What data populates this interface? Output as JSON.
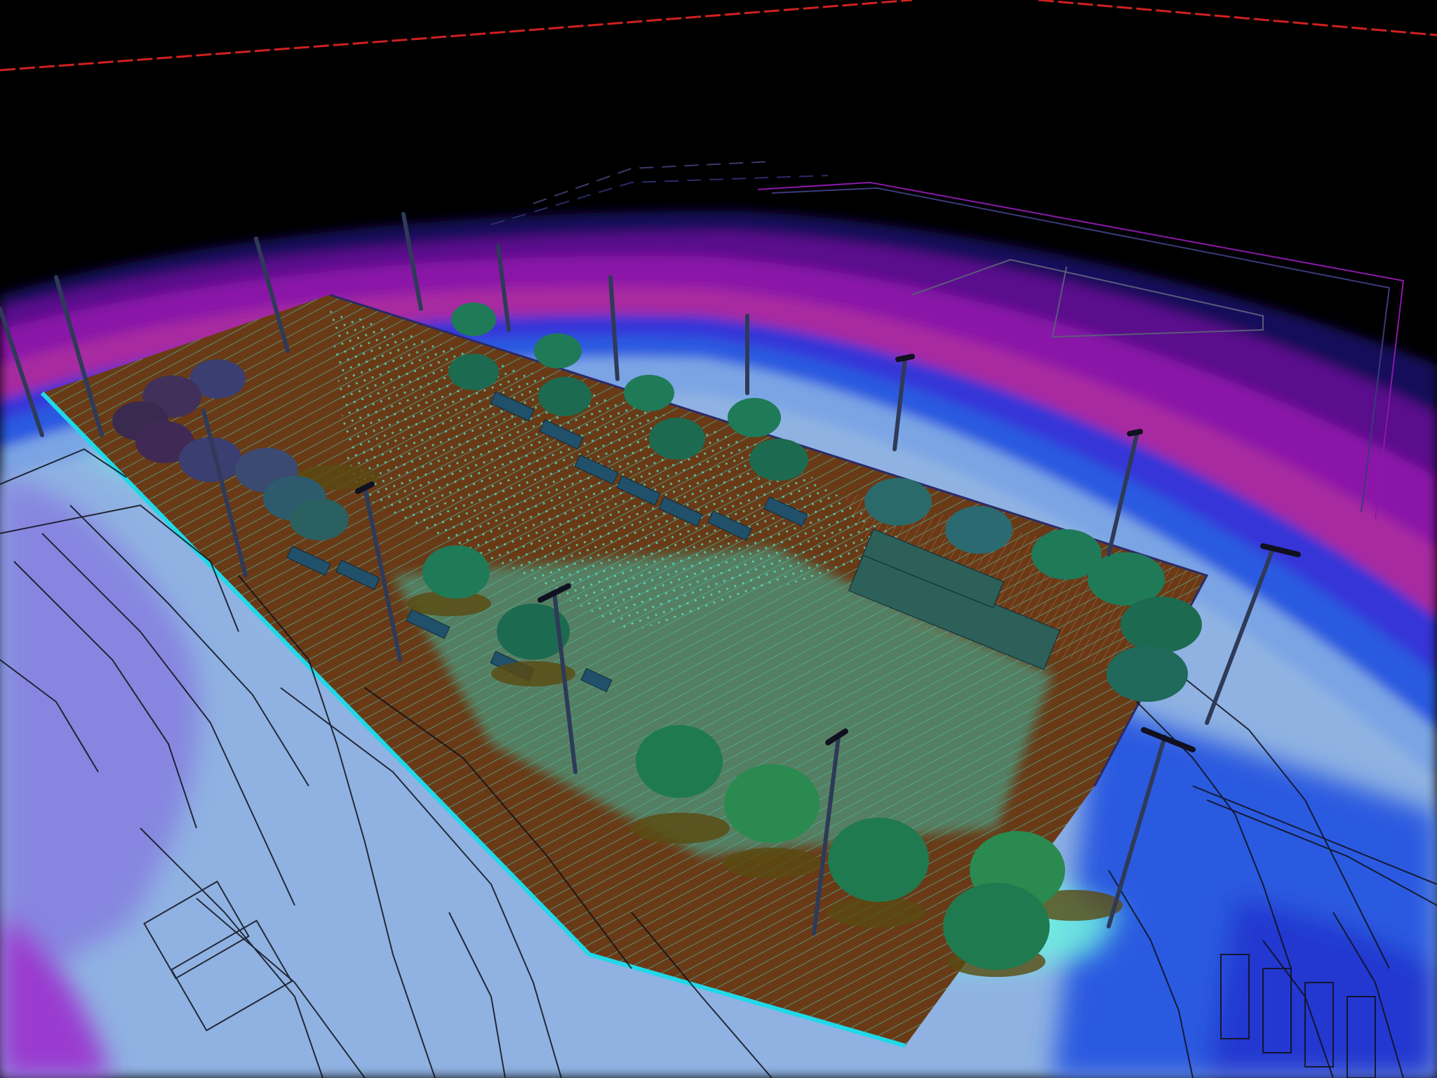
{
  "viewport": {
    "background": "#000000",
    "palette": {
      "far_dark": "#0b0530",
      "navy": "#15105a",
      "violet": "#5a0f8c",
      "magenta": "#8a18a8",
      "pink": "#b02a9c",
      "blue": "#3434d8",
      "royal": "#2a5ae0",
      "sky": "#6e96dc",
      "light_blue": "#8caee0",
      "periwinkle": "#8686e0",
      "lavender": "#a09ee8",
      "aqua": "#6ef0e0",
      "mint": "#a8f4d4",
      "yellow_green": "#c8d890",
      "cyan": "#20d8e8",
      "plaza": "#6a3a16",
      "plaza_grid": "#3fd8c8",
      "tree_dark": "#16604a",
      "tree_mid": "#1f7a50",
      "tree_light": "#2a9a58",
      "tree_shade": "#3a3e70",
      "pole": "#2e3a58",
      "linework": "#101018",
      "boundary_red": "#d02020"
    }
  }
}
